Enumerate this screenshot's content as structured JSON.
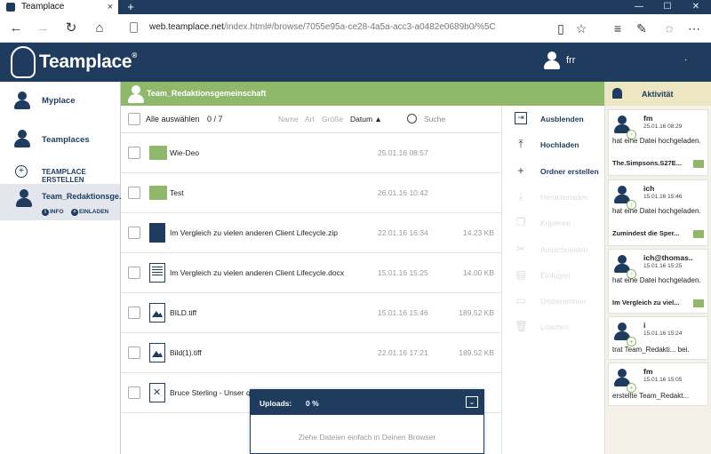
{
  "browser": {
    "tab_title": "Teamplace",
    "tab_close": "×",
    "new_tab": "+",
    "url_domain": "web.teamplace.net",
    "url_path": "/index.html#/browse/7055e95a-ce28-4a5a-acc3-a0482e0689b0/%5C",
    "window_controls": [
      "—",
      "☐",
      "✕"
    ],
    "nav_icons": [
      "back-icon",
      "forward-icon",
      "refresh-icon",
      "home-icon"
    ],
    "toolbar_icons": [
      "reading-view-icon",
      "favorite-icon",
      "favorites-hub-icon",
      "notes-icon",
      "share-icon",
      "more-icon"
    ]
  },
  "app": {
    "brand": "Teamplace",
    "brand_mark": "®",
    "user_name": "frr",
    "user_menu": "·"
  },
  "sidebar": {
    "myplace": "Myplace",
    "teamplaces": "Teamplaces",
    "create": "TEAMPLACE ERSTELLEN",
    "active_team": "Team_Redaktionsge...",
    "info": "INFO",
    "invite": "EINLADEN"
  },
  "team": {
    "name": "Team_Redaktionsgemeinschaft"
  },
  "filelist": {
    "select_all": "Alle auswählen",
    "count": "0 / 7",
    "sort": {
      "name": "Name",
      "type": "Art",
      "size": "Größe",
      "date": "Datum",
      "date_arrow": "▲"
    },
    "search_label": "Suche",
    "rows": [
      {
        "type": "folder",
        "name": "Wie-Deo",
        "date": "25.01.16 08:57",
        "size": ""
      },
      {
        "type": "folder",
        "name": "Test",
        "date": "26.01.16 10:42",
        "size": ""
      },
      {
        "type": "zip",
        "name": "Im Vergleich zu vielen anderen Client Lifecycle.zip",
        "date": "22.01.16 16:34",
        "size": "14.23 KB"
      },
      {
        "type": "docx",
        "name": "Im Vergleich zu vielen anderen Client Lifecycle.docx",
        "date": "15.01.16 15:25",
        "size": "14.00 KB"
      },
      {
        "type": "image",
        "name": "BILD.tiff",
        "date": "15.01.16 15:46",
        "size": "189.52 KB"
      },
      {
        "type": "image",
        "name": "Bild(1).tiff",
        "date": "22.01.16 17:21",
        "size": "189.52 KB"
      },
      {
        "type": "pdf",
        "name": "Bruce Sterling - Unser q",
        "date": "",
        "size": ""
      }
    ]
  },
  "uploads": {
    "title": "Uploads:",
    "percent": "0 %",
    "collapse": "⌄",
    "hint": "Ziehe Dateien einfach in Deinen Browser"
  },
  "actions": [
    {
      "label": "Ausblenden",
      "icon": "⇥",
      "enabled": true
    },
    {
      "label": "Hochladen",
      "icon": "⤒",
      "enabled": true
    },
    {
      "label": "Ordner erstellen",
      "icon": "+",
      "enabled": true
    },
    {
      "label": "Herunterladen",
      "icon": "⤓",
      "enabled": false
    },
    {
      "label": "Kopieren",
      "icon": "❐",
      "enabled": false
    },
    {
      "label": "Ausschneiden",
      "icon": "✂",
      "enabled": false
    },
    {
      "label": "Einfügen",
      "icon": "▤",
      "enabled": false
    },
    {
      "label": "Umbenennen",
      "icon": "▭",
      "enabled": false
    },
    {
      "label": "Löschen",
      "icon": "🗑",
      "enabled": false
    }
  ],
  "activity": {
    "title": "Aktivität",
    "items": [
      {
        "user": "fm",
        "time": "25.01.16 08:29",
        "text": "hat eine Datei hochgeladen.",
        "file": "The.Simpsons.S27E..."
      },
      {
        "user": "ich",
        "time": "15.01.16 15:46",
        "text": "hat eine Datei hochgeladen.",
        "file": "Zumindest die Sper..."
      },
      {
        "user": "ich@thomas..",
        "time": "15.01.16 15:25",
        "text": "hat eine Datei hochgeladen.",
        "file": "Im Vergleich zu viel..."
      },
      {
        "user": "i",
        "time": "15.01.16 15:24",
        "text": "trat Team_Redakti... bei.",
        "file": ""
      },
      {
        "user": "fm",
        "time": "15.01.16 15:05",
        "text": "erstellte Team_Redakt...",
        "file": ""
      }
    ]
  },
  "colors": {
    "navy": "#1f3b5e",
    "green": "#8fb86b",
    "activity_header": "#ede6c3"
  }
}
